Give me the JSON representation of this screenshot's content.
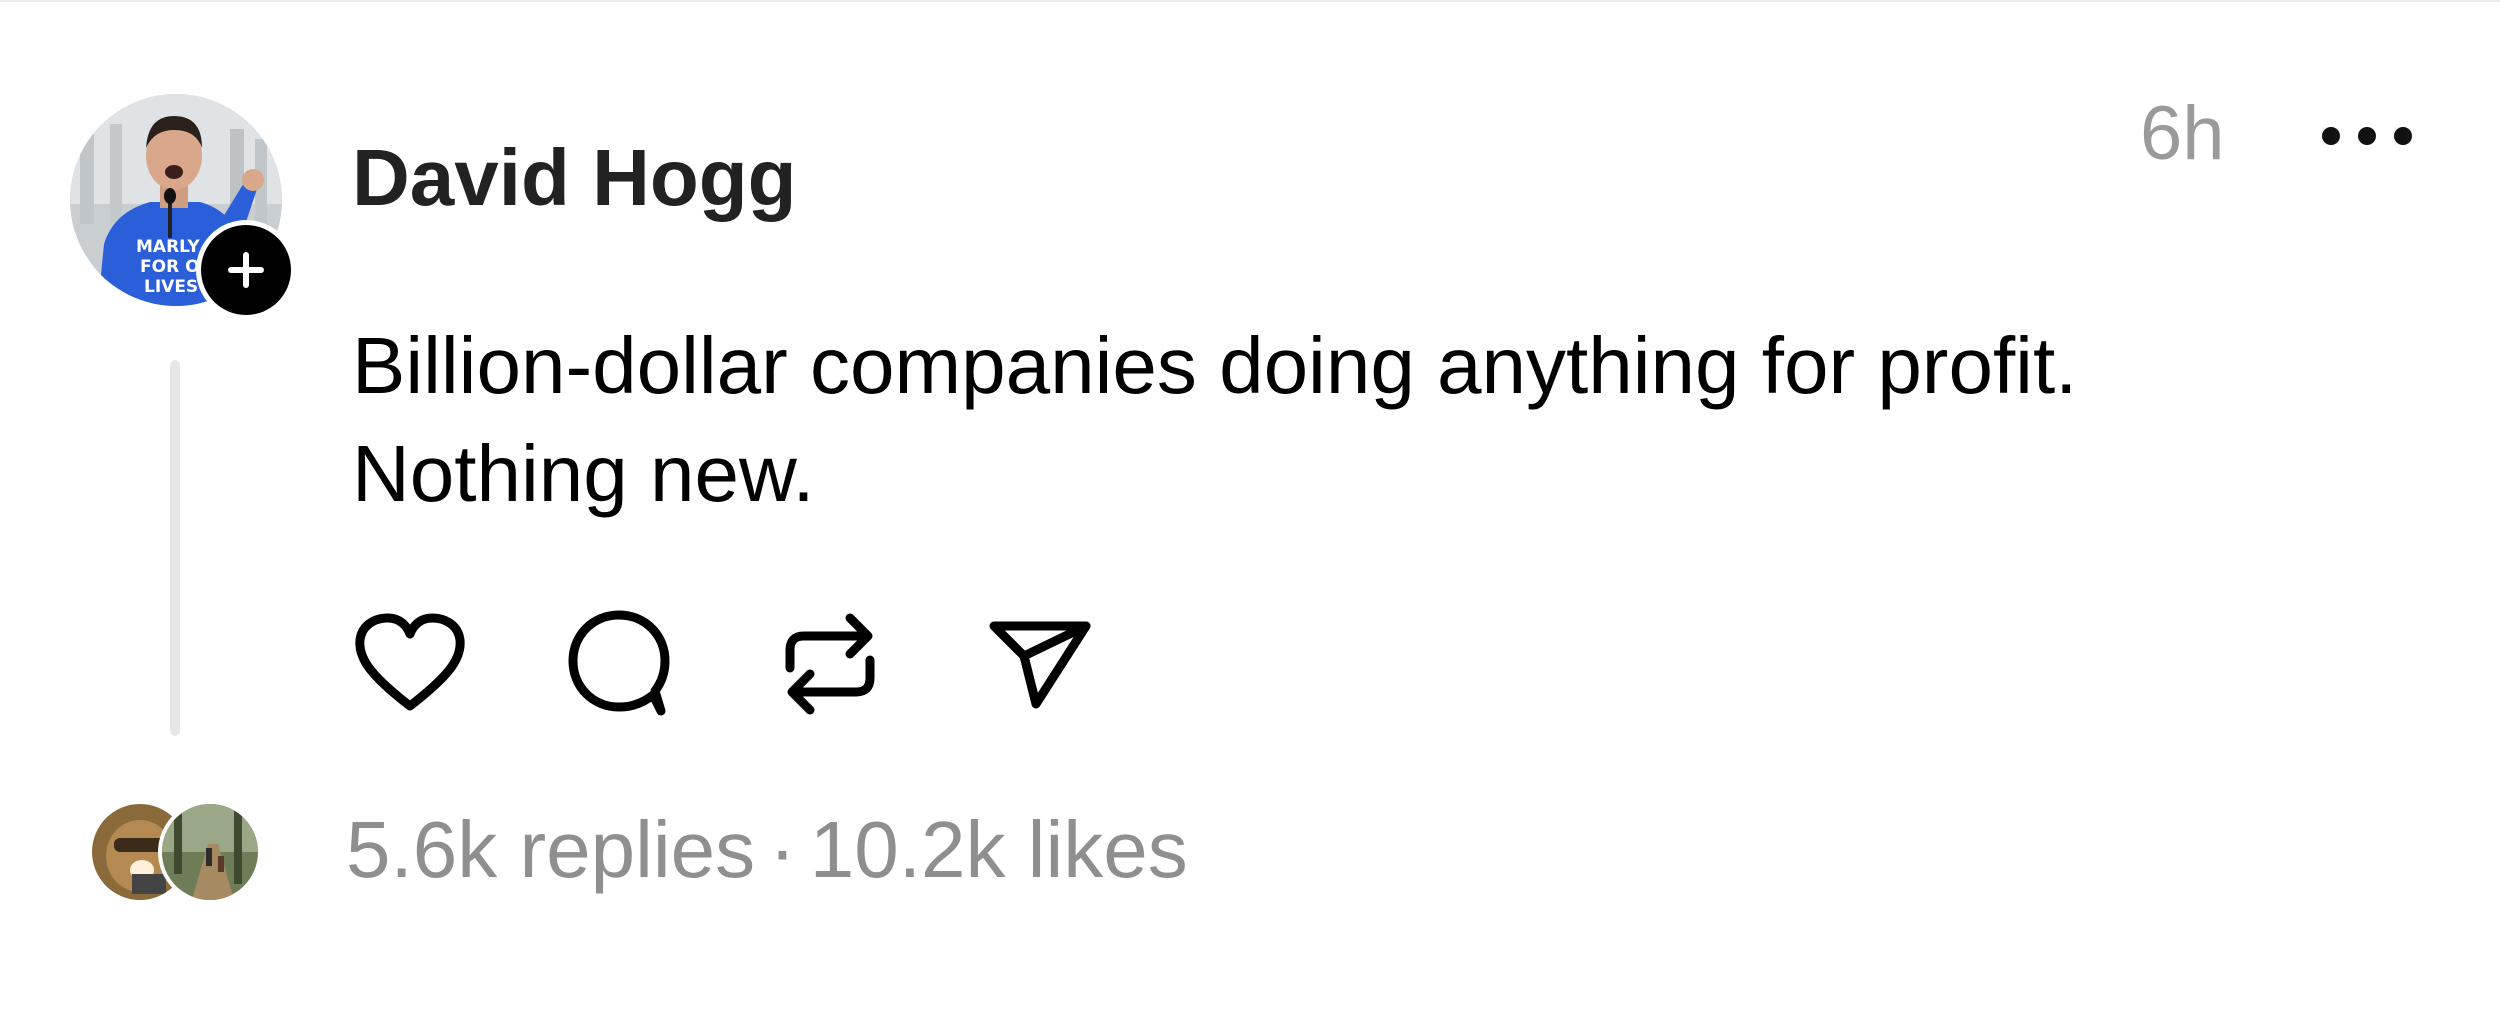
{
  "post": {
    "author": "David Hogg",
    "timestamp": "6h",
    "text_lines": [
      "Billion-dollar companies doing anything for profit.",
      "Nothing new."
    ]
  },
  "avatar": {
    "shirt_text": [
      "MARLY",
      "FOR OI",
      "LIVES"
    ]
  },
  "stats": {
    "replies": "5.6k replies",
    "separator": "·",
    "likes": "10.2k likes"
  },
  "actions": [
    {
      "name": "like",
      "icon": "heart-icon"
    },
    {
      "name": "reply",
      "icon": "comment-icon"
    },
    {
      "name": "repost",
      "icon": "repost-icon"
    },
    {
      "name": "share",
      "icon": "send-icon"
    }
  ],
  "colors": {
    "text": "#000000",
    "muted": "#8f8f8f",
    "thread_line": "#e6e6e6",
    "badge": "#000000",
    "shirt": "#2b5fd9"
  }
}
